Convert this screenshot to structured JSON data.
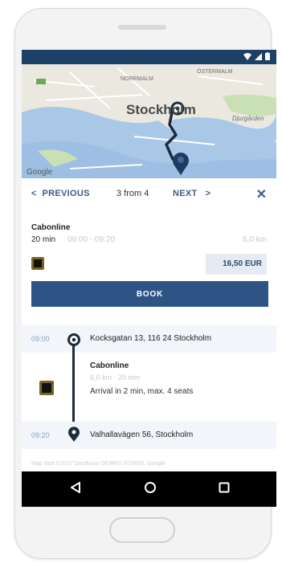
{
  "map": {
    "labels": {
      "district_top": "NORRMALM",
      "district_right": "ÖSTERMALM",
      "city": "Stockholm",
      "island": "Djurgården",
      "google": "Google"
    },
    "route_color": "#1c2b3f",
    "water_color": "#a9c8e8"
  },
  "pager": {
    "previous_label": "PREVIOUS",
    "position_label": "3 from 4",
    "next_label": "NEXT",
    "previous_icon": "chevron-left-icon",
    "next_icon": "chevron-right-icon",
    "close_icon": "close-icon"
  },
  "ride": {
    "provider": "Cabonline",
    "duration": "20 min",
    "times": "09:00 - 09:20",
    "distance": "6,0 km",
    "price": "16,50 EUR",
    "book_label": "BOOK"
  },
  "timeline": {
    "origin": {
      "time": "09:00",
      "address": "Kocksgatan 13, 116 24 Stockholm"
    },
    "leg": {
      "provider": "Cabonline",
      "meta": "6,0 km · 20 min",
      "arrival": "Arrival in 2 min, max. 4 seats"
    },
    "destination": {
      "time": "09:20",
      "address": "Valhallavägen 56, Stockholm"
    },
    "attribution": "Map data ©2017 GeoBasis-DE/BKG (©2009), Google"
  },
  "colors": {
    "status_bar": "#1c4066",
    "accent": "#2d5484",
    "link": "#3b5c8a",
    "price_bg": "#e4ebf3"
  }
}
